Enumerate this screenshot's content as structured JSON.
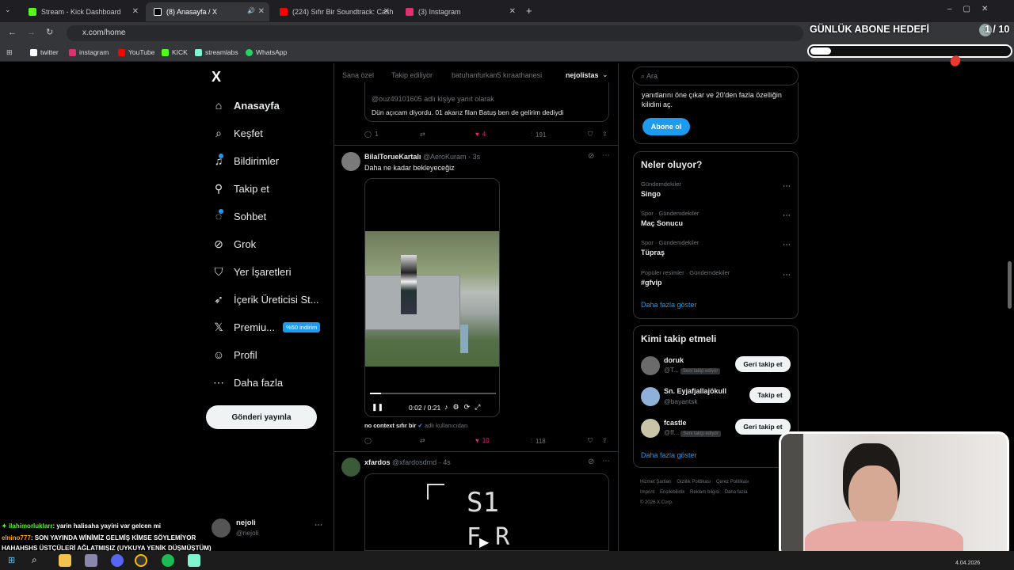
{
  "tabs": [
    {
      "label": "Stream - Kick Dashboard",
      "color": "#53fc18"
    },
    {
      "label": "(8) Anasayfa / X",
      "color": "#ffffff"
    },
    {
      "label": "(224) Sıfır Bir Soundtrack: Cash",
      "color": "#ff0000"
    },
    {
      "label": "(3) Instagram",
      "color": "#e1306c"
    }
  ],
  "address": {
    "url": "x.com/home"
  },
  "bookmarks": [
    {
      "label": "twitter",
      "color": "#ffffff"
    },
    {
      "label": "instagram",
      "color": "#e1306c"
    },
    {
      "label": "YouTube",
      "color": "#ff0000"
    },
    {
      "label": "KICK",
      "color": "#53fc18"
    },
    {
      "label": "streamlabs",
      "color": "#80f5d2"
    },
    {
      "label": "WhatsApp",
      "color": "#25d366"
    }
  ],
  "overlay": {
    "goal_title": "GÜNLÜK ABONE HEDEFİ",
    "goal_count": "1 / 10",
    "goal_progress": 0.1
  },
  "sidebar": {
    "logo": "X",
    "items": [
      {
        "label": "Anasayfa",
        "icon": "home-icon"
      },
      {
        "label": "Keşfet",
        "icon": "search-icon"
      },
      {
        "label": "Bildirimler",
        "icon": "bell-icon"
      },
      {
        "label": "Takip et",
        "icon": "person-add-icon"
      },
      {
        "label": "Sohbet",
        "icon": "chat-icon"
      },
      {
        "label": "Grok",
        "icon": "grok-icon"
      },
      {
        "label": "Yer İşaretleri",
        "icon": "bookmark-icon"
      },
      {
        "label": "İçerik Üreticisi St...",
        "icon": "rocket-icon"
      },
      {
        "label": "Premiu...",
        "icon": "x-icon"
      },
      {
        "label": "Profil",
        "icon": "person-icon"
      },
      {
        "label": "Daha fazla",
        "icon": "more-icon"
      }
    ],
    "premium_badge": "%50 indirim",
    "post_button": "Gönderi yayınla",
    "account_name": "nejoli",
    "account_handle": "@nejoli"
  },
  "feed_tabs": [
    "Sana özel",
    "Takip ediliyor",
    "batuhanfurkan5 kıraathanesi",
    "nejolistas"
  ],
  "tweet1": {
    "reply_to": "@ouz49101605 adlı kişiye yanıt olarak",
    "text": "Dün açıcam diyordu. 01 akarız filan Batuş ben de gelirim dediydi",
    "replies": "1",
    "likes": "4",
    "views": "191"
  },
  "tweet2": {
    "name": "BilalTorueKartalı",
    "handle": "@AeroKuram",
    "time": "3s",
    "text": "Daha ne kadar bekleyeceğiz",
    "video_time": "0:02 / 0:21",
    "source_name": "no context sıfır bir",
    "source_suffix": "adlı kullanıcıdan",
    "likes": "10",
    "views": "118"
  },
  "tweet3": {
    "name": "xfardos",
    "handle": "@xfardosdmd",
    "time": "4s",
    "video_text_1": "S1",
    "video_text_2": "F R"
  },
  "right": {
    "search_placeholder": "Ara",
    "premium_text": "yanıtlarını öne çıkar ve 20'den fazla özelliğin kilidini aç.",
    "subscribe_button": "Abone ol",
    "trends_title": "Neler oluyor?",
    "trends": [
      {
        "category": "Gündemdekiler",
        "name": "Singo"
      },
      {
        "category": "Spor · Gündemdekiler",
        "name": "Maç Sonucu"
      },
      {
        "category": "Spor · Gündemdekiler",
        "name": "Tüpraş"
      },
      {
        "category": "Popüler resimler · Gündemdekiler",
        "name": "#gfvip"
      }
    ],
    "show_more": "Daha fazla göster",
    "who_title": "Kimi takip etmeli",
    "who": [
      {
        "name": "doruk",
        "handle": "@T...",
        "badge": "Seni takip ediyor",
        "button": "Geri takip et"
      },
      {
        "name": "Sn. Eyjafjallajökull",
        "handle": "@bayantsk",
        "badge": "",
        "button": "Takip et"
      },
      {
        "name": "fcastle",
        "handle": "@ff...",
        "badge": "Seni takip ediyor",
        "button": "Geri takip et"
      }
    ],
    "who_more": "Daha fazla göster",
    "footer_links": [
      "Hizmet Şartları",
      "Gizlilik Politikası",
      "Çerez Politikası",
      "Imprint",
      "Erişilebilirlik",
      "Reklam bilgisi",
      "Daha fazla"
    ],
    "copyright": "© 2026 X Corp."
  },
  "chat": [
    {
      "user": "ilahimorluklarr",
      "msg": ": yarin halisaha yayini var gelcen mi",
      "color": "#53fc18"
    },
    {
      "user": "elnino777",
      "msg": ": SON YAYINDA WİNİMİZ GELMİŞ KİMSE SÖYLEMİYOR",
      "color": "#ff9f1a"
    },
    {
      "user": "",
      "msg": "HAHAHSHS ÜSTÇÜLERİ AĞLATMIŞIZ (UYKUYA YENİK DÜŞMÜŞTÜM)",
      "color": "#ffffff"
    }
  ],
  "taskbar": {
    "date": "4.04.2026"
  }
}
